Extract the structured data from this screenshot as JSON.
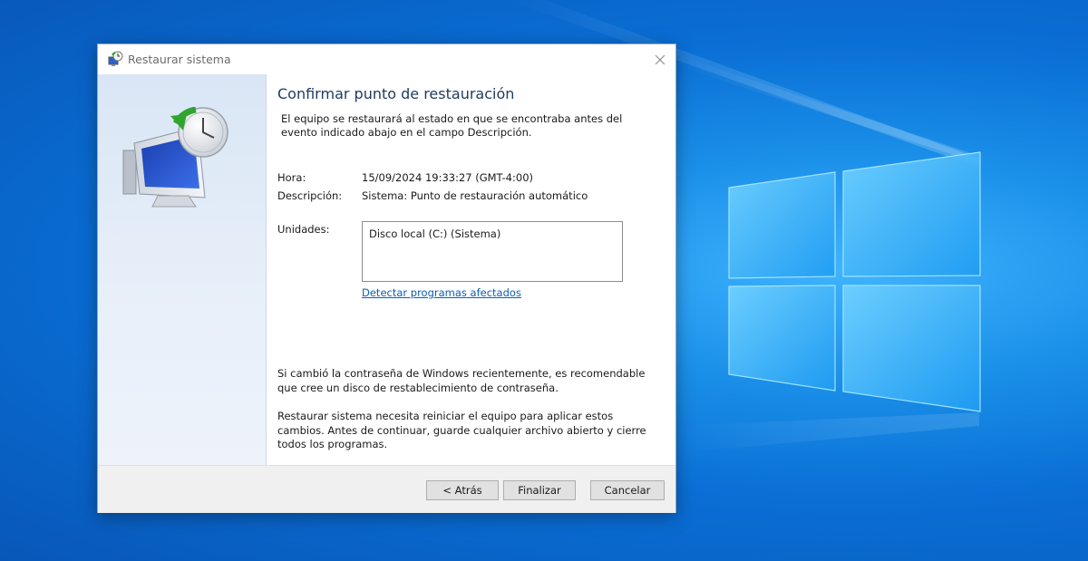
{
  "window": {
    "title": "Restaurar sistema",
    "title_icon": "system-restore-icon",
    "close_icon": "close-icon"
  },
  "side_panel": {
    "illustration": "monitor-clock-restore-icon"
  },
  "content": {
    "heading": "Confirmar punto de restauración",
    "intro": "El equipo se restaurará al estado en que se encontraba antes del evento indicado abajo en el campo Descripción.",
    "fields": {
      "time_label": "Hora:",
      "time_value": "15/09/2024 19:33:27 (GMT-4:00)",
      "description_label": "Descripción:",
      "description_value": "Sistema: Punto de restauración automático",
      "drives_label": "Unidades:",
      "drives": [
        "Disco local (C:) (Sistema)"
      ]
    },
    "link": "Detectar programas afectados",
    "password_note": "Si cambió la contraseña de Windows recientemente, es recomendable que cree un disco de restablecimiento de contraseña.",
    "restart_note": "Restaurar sistema necesita reiniciar el equipo para aplicar estos cambios. Antes de continuar, guarde cualquier archivo abierto y cierre todos los programas."
  },
  "buttons": {
    "back": "< Atrás",
    "finish": "Finalizar",
    "cancel": "Cancelar"
  },
  "colors": {
    "desktop_blue": "#0a6fd6",
    "heading_blue": "#1e3a5f",
    "link_blue": "#0a5fb4"
  }
}
